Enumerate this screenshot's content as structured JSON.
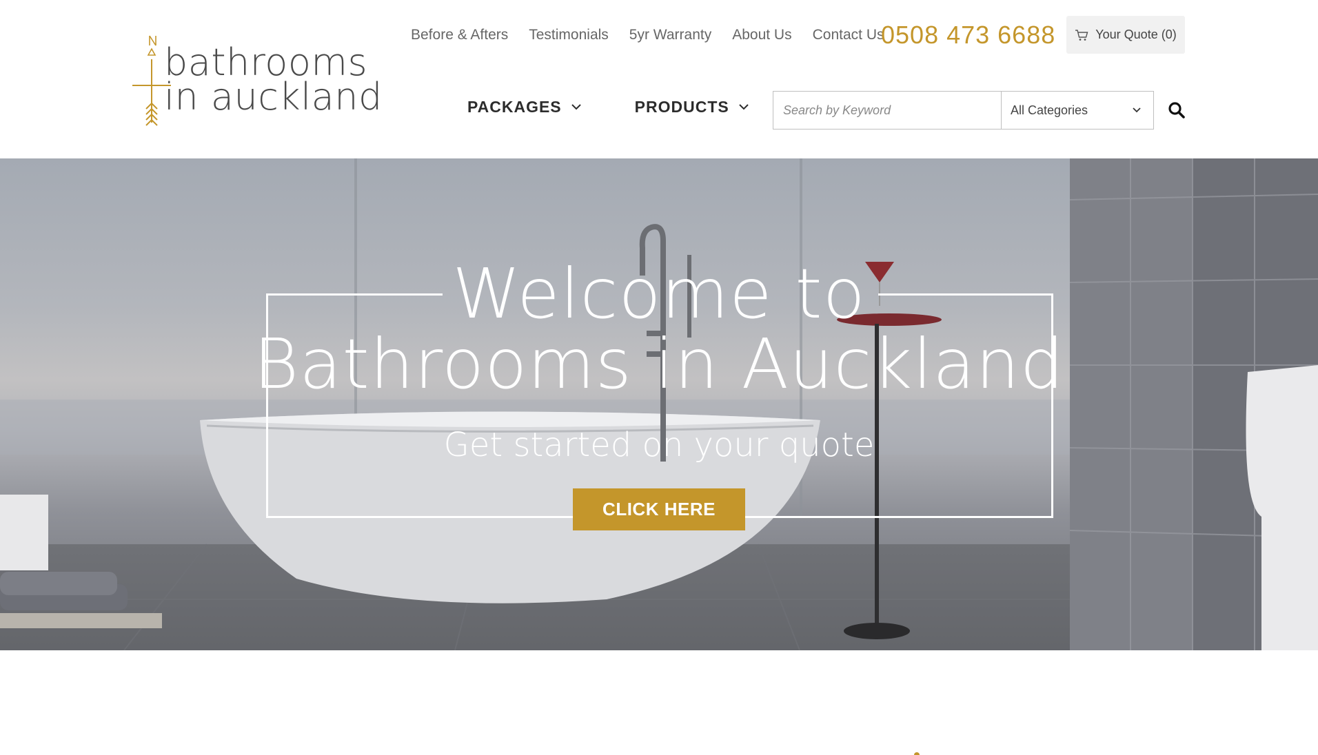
{
  "header": {
    "logo": {
      "line1": "bathrooms",
      "line2": "in auckland",
      "icon": "arrow-monogram-icon"
    },
    "top_nav": [
      "Before & Afters",
      "Testimonials",
      "5yr Warranty",
      "About Us",
      "Contact Us"
    ],
    "phone": "0508 473 6688",
    "quote_button": {
      "label": "Your Quote (0)",
      "icon": "cart-icon"
    },
    "main_nav": [
      {
        "label": "PACKAGES",
        "icon": "chevron-down-icon"
      },
      {
        "label": "PRODUCTS",
        "icon": "chevron-down-icon"
      }
    ],
    "search": {
      "placeholder": "Search by Keyword",
      "category_selected": "All Categories",
      "icon": "search-icon"
    }
  },
  "hero": {
    "title_line1": "Welcome to",
    "title_line2": "Bathrooms in Auckland",
    "subtitle": "Get started on your quote",
    "cta_label": "CLICK HERE"
  },
  "colors": {
    "accent": "#c4962b",
    "nav_text": "#666666",
    "heading_text": "#2c2c2c"
  }
}
